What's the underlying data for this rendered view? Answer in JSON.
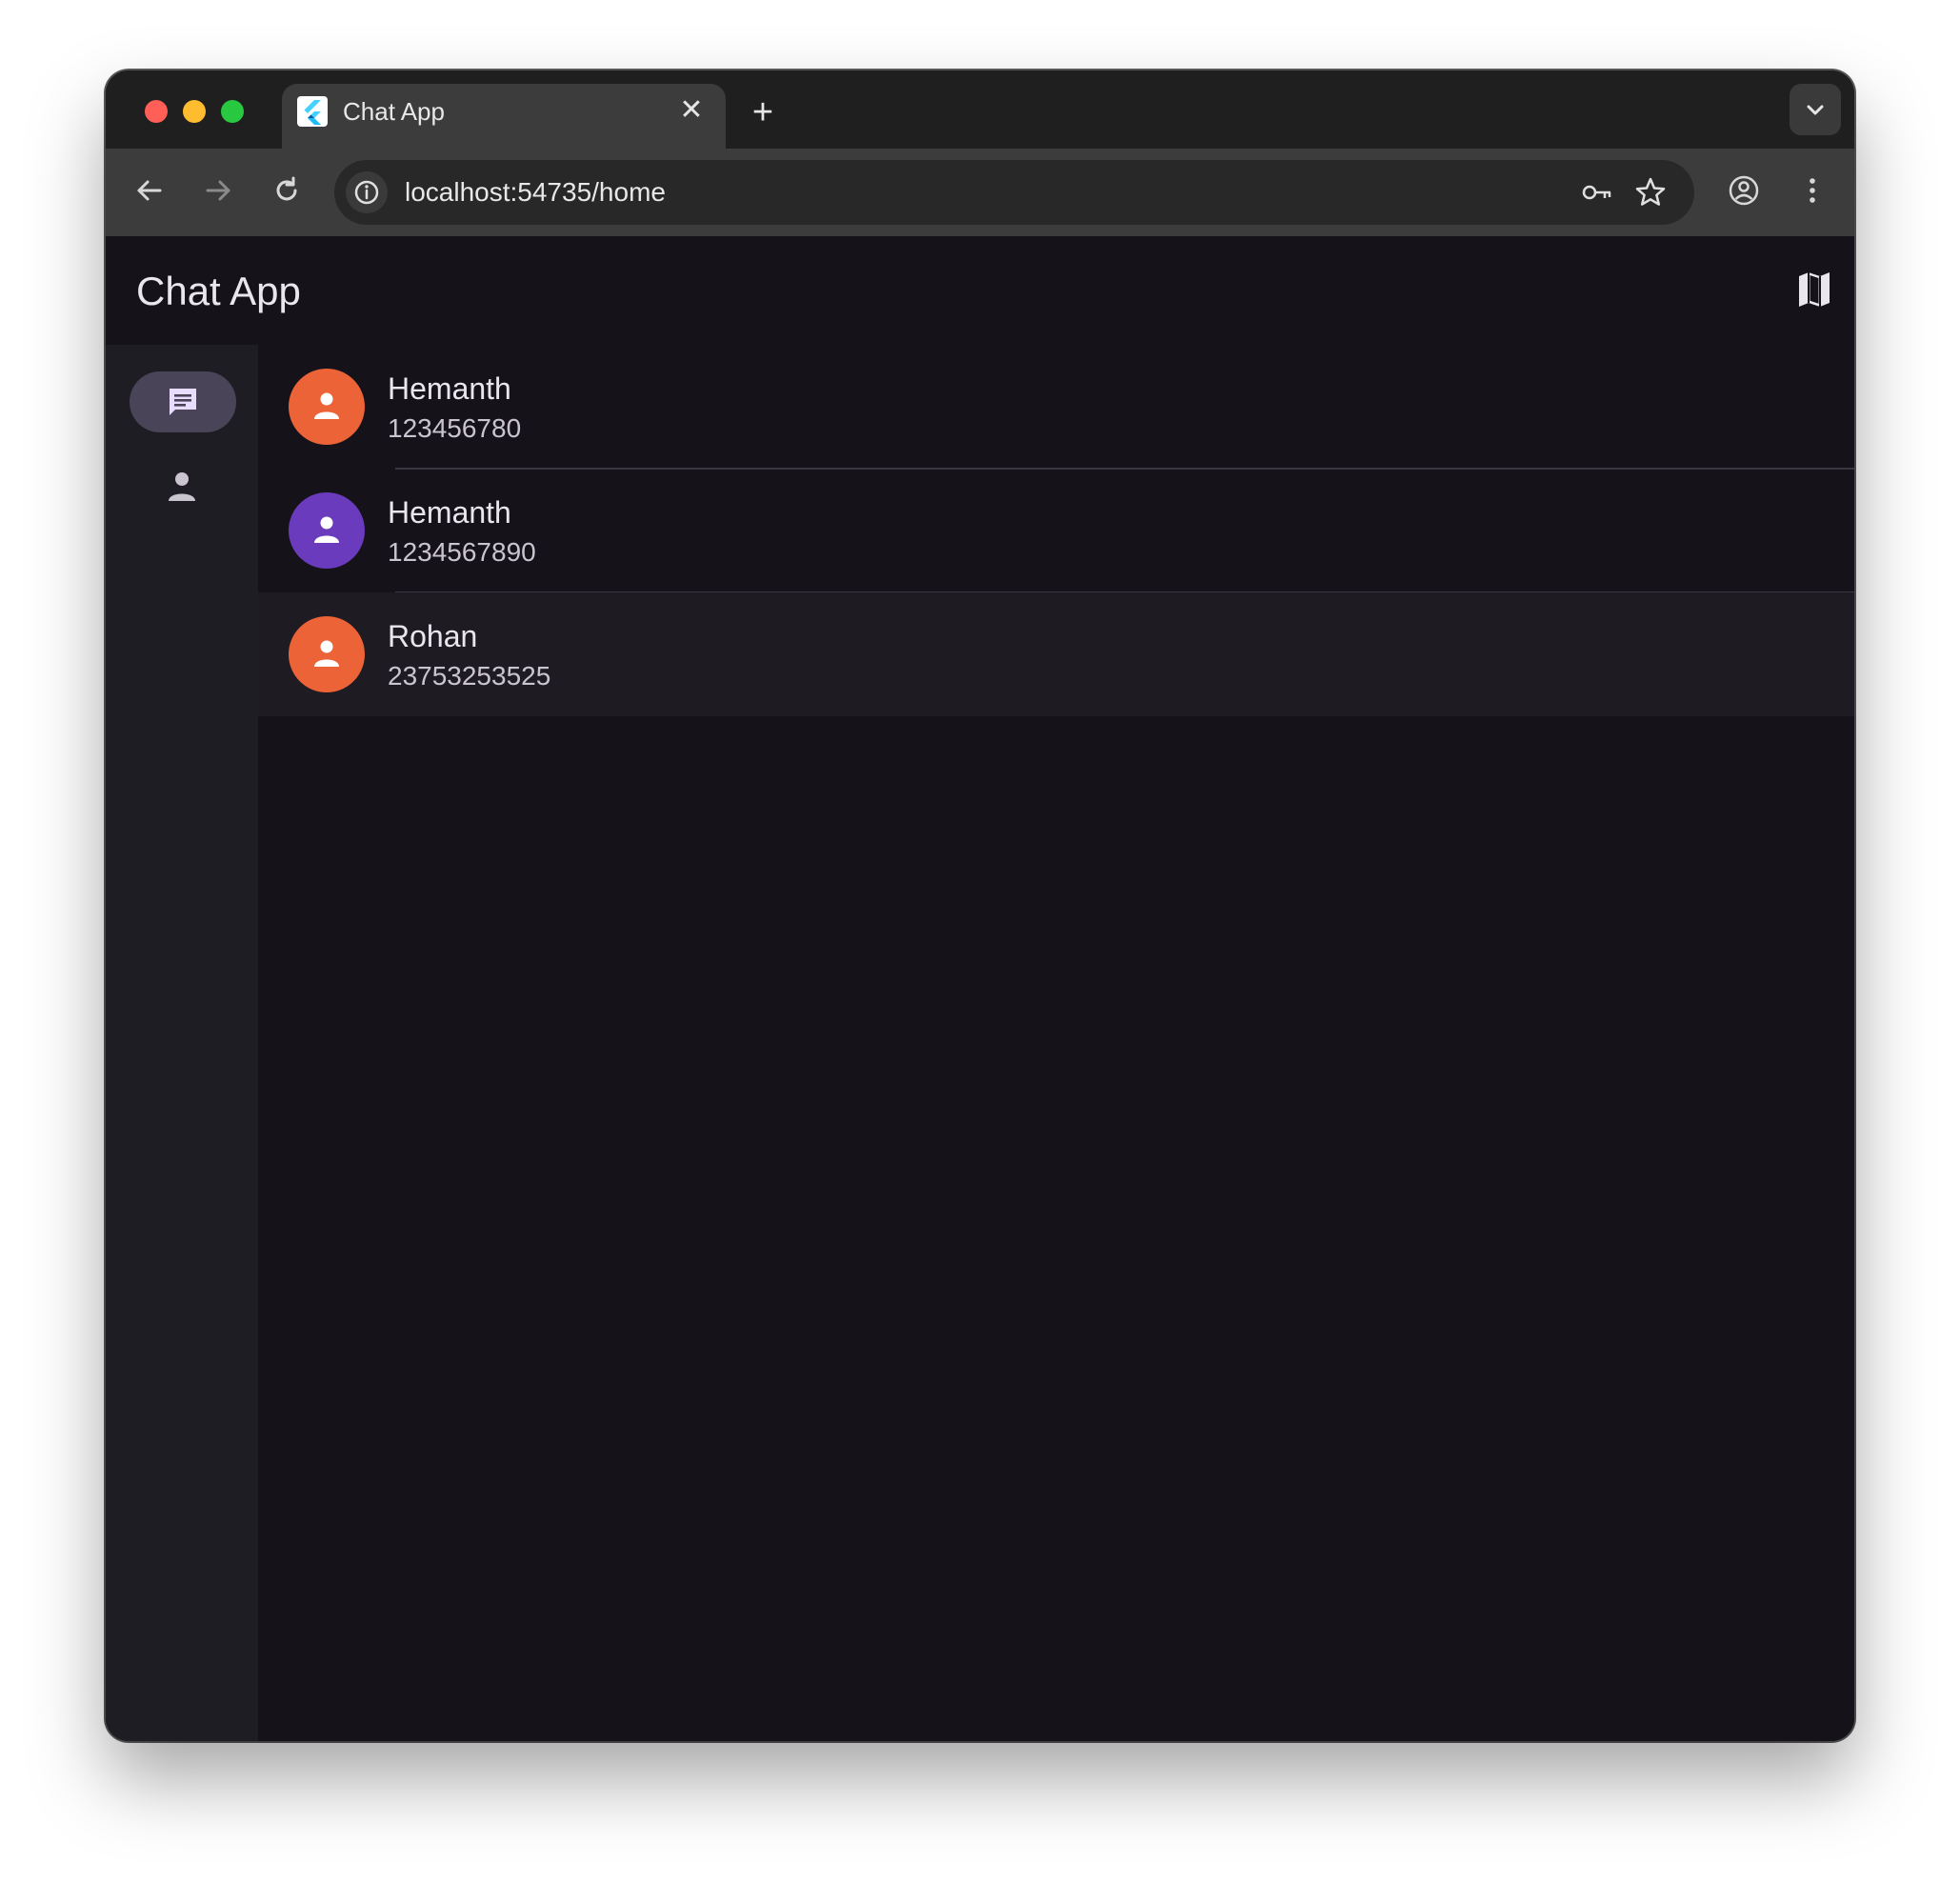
{
  "browser": {
    "tab_title": "Chat App",
    "tab_close_icon": "close-icon",
    "new_tab_icon": "plus-icon",
    "url": "localhost:54735/home"
  },
  "app": {
    "title": "Chat App",
    "map_icon": "map-icon"
  },
  "rail": {
    "items": [
      {
        "icon": "chat-icon",
        "selected": true
      },
      {
        "icon": "person-icon",
        "selected": false
      }
    ]
  },
  "contacts": [
    {
      "name": "Hemanth",
      "phone": "123456780",
      "avatar_color": "#ec6338"
    },
    {
      "name": "Hemanth",
      "phone": "1234567890",
      "avatar_color": "#6a3bbc"
    },
    {
      "name": "Rohan",
      "phone": "23753253525",
      "avatar_color": "#ec6338"
    }
  ],
  "colors": {
    "app_background": "#151319",
    "rail_background": "#1f1d24",
    "rail_selected": "#4a4458"
  }
}
